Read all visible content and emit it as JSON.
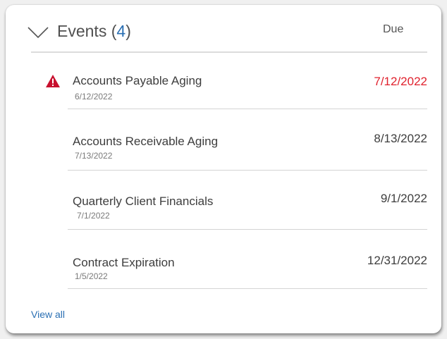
{
  "widget": {
    "title": "Events",
    "count_open": "(",
    "count": "4",
    "count_close": ")",
    "due_header": "Due",
    "view_all_label": "View all"
  },
  "events": [
    {
      "name": "Accounts Payable Aging",
      "date": "6/12/2022",
      "due": "7/12/2022",
      "overdue": true,
      "icon": "warning-icon"
    },
    {
      "name": "Accounts Receivable Aging",
      "date": "7/13/2022",
      "due": "8/13/2022",
      "overdue": false
    },
    {
      "name": "Quarterly Client Financials",
      "date": "7/1/2022",
      "due": "9/1/2022",
      "overdue": false
    },
    {
      "name": "Contract Expiration",
      "date": "1/5/2022",
      "due": "12/31/2022",
      "overdue": false
    }
  ],
  "colors": {
    "accent": "#2a6fb3",
    "overdue": "#e0212d",
    "warning_icon": "#c8102e"
  }
}
